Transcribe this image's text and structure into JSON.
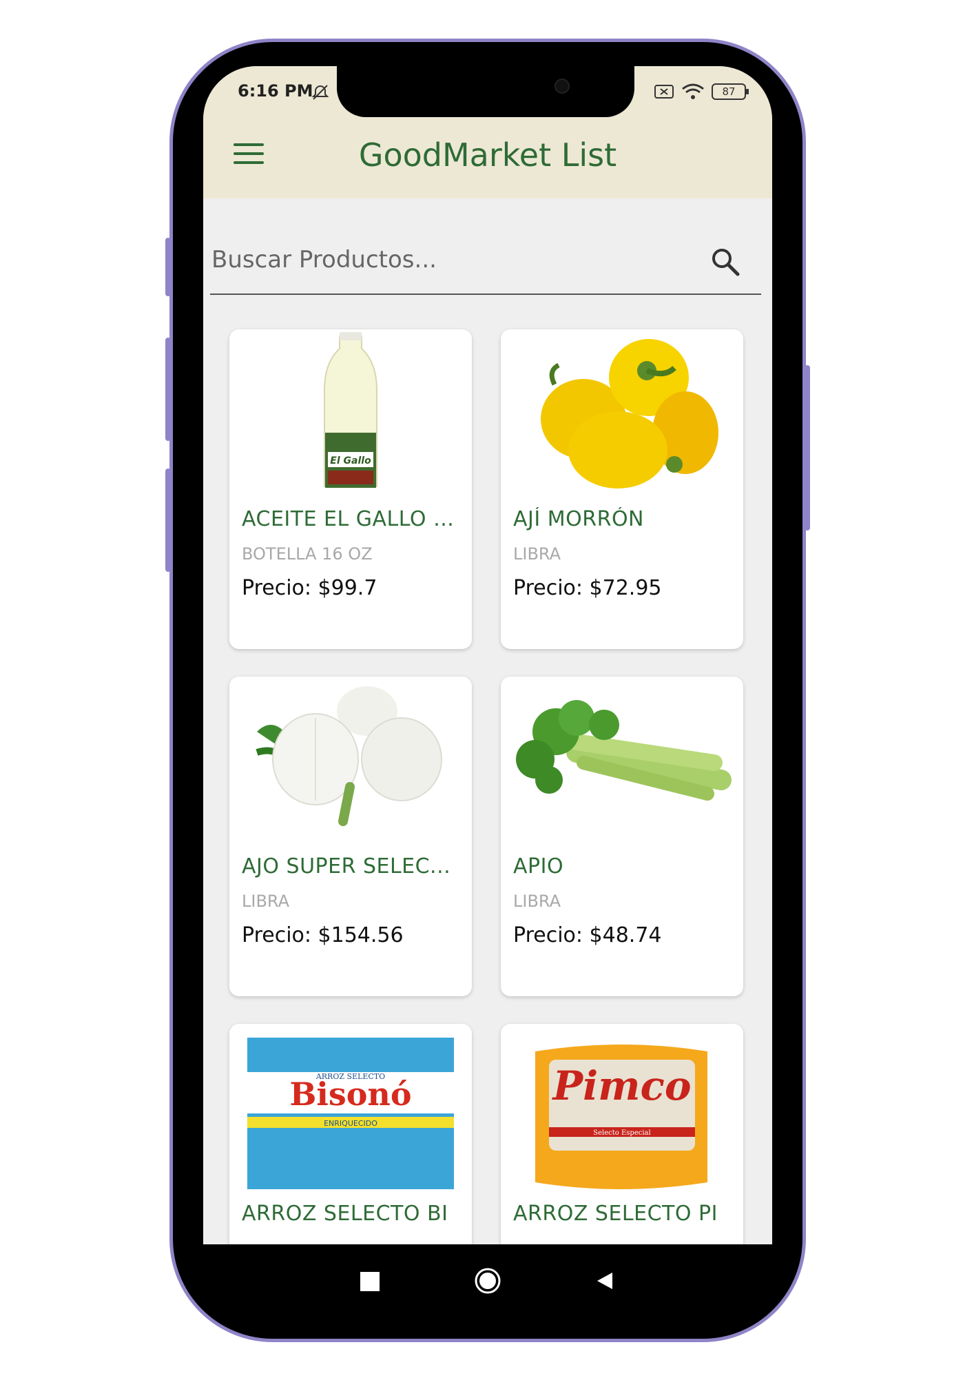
{
  "status": {
    "time": "6:16 PM",
    "battery": "87"
  },
  "appbar": {
    "title": "GoodMarket List"
  },
  "search": {
    "placeholder": "Buscar Productos..."
  },
  "products": [
    {
      "name": "ACEITE EL GALLO (...",
      "unit": "BOTELLA 16 OZ",
      "price": "Precio: $99.7"
    },
    {
      "name": "AJÍ MORRÓN",
      "unit": "LIBRA",
      "price": "Precio: $72.95"
    },
    {
      "name": "AJO SUPER SELEC...",
      "unit": "LIBRA",
      "price": "Precio: $154.56"
    },
    {
      "name": "APIO",
      "unit": "LIBRA",
      "price": "Precio: $48.74"
    },
    {
      "name": "ARROZ SELECTO BI",
      "unit": "",
      "price": ""
    },
    {
      "name": "ARROZ SELECTO PI",
      "unit": "",
      "price": ""
    }
  ],
  "brands": {
    "bisono_top": "ARROZ SELECTO",
    "bisono": "Bisonó",
    "bisono_band": "ENRIQUECIDO",
    "pimco": "Pimco",
    "pimco_sub": "Selecto Especial",
    "gallo": "El Gallo"
  },
  "colors": {
    "accent": "#2e6b36",
    "appbar": "#ede8d4",
    "frame": "#8f84c8"
  }
}
